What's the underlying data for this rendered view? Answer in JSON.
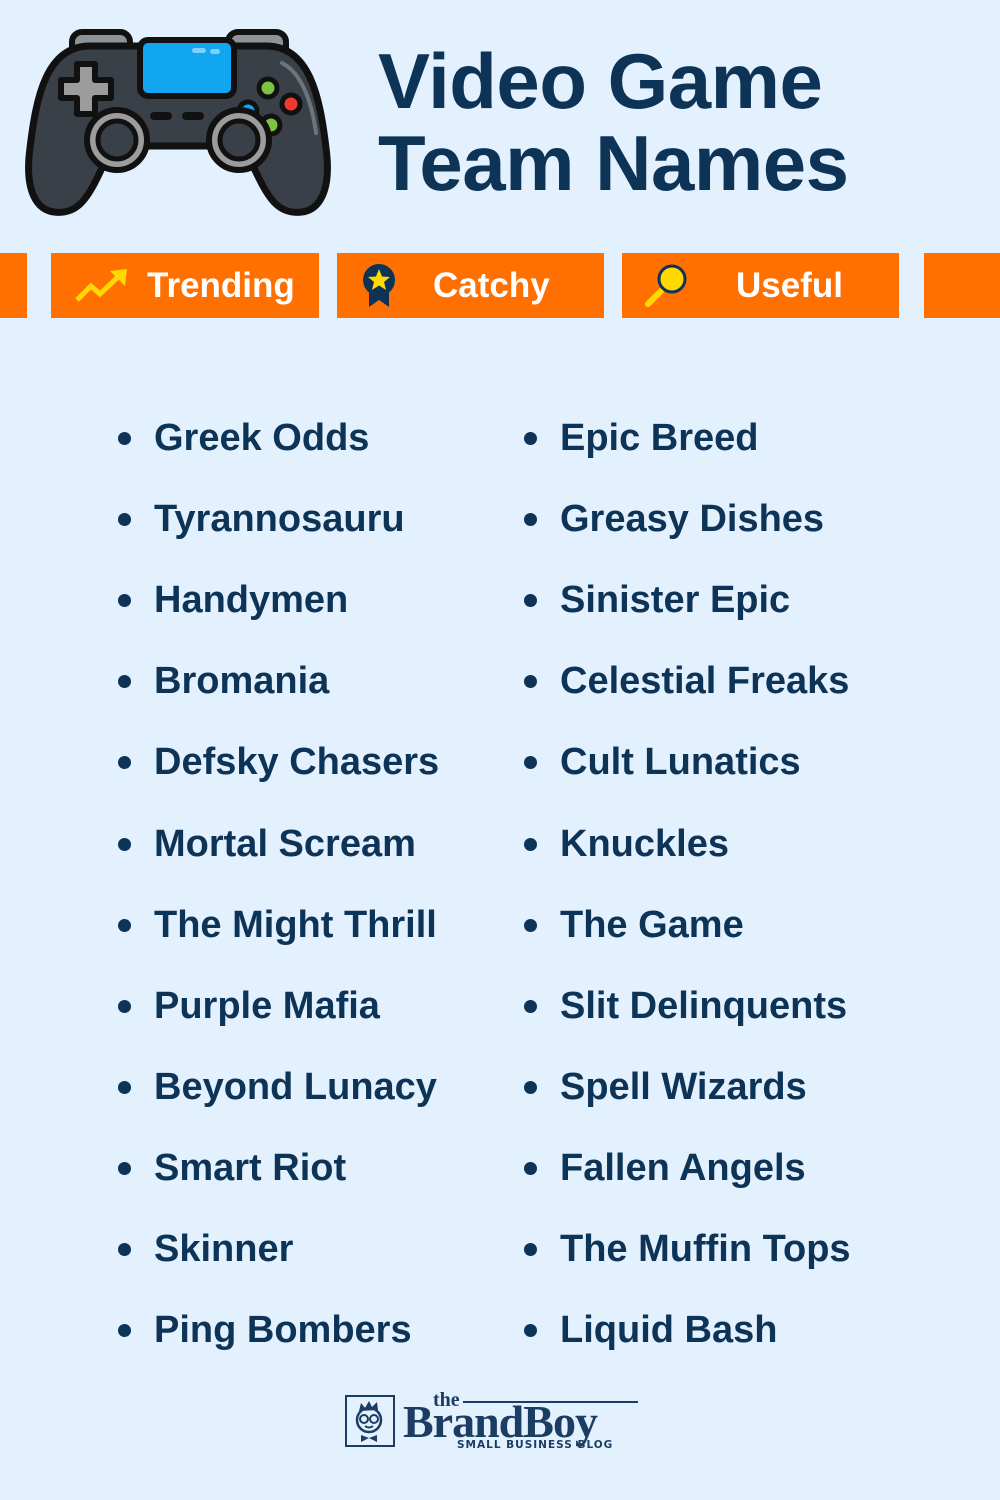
{
  "header": {
    "title_line1": "Video Game",
    "title_line2": "Team Names",
    "hero_icon": "gamepad-controller-icon"
  },
  "colors": {
    "background": "#e3f0fe",
    "text": "#0d3356",
    "tab_background": "#ff7001",
    "tab_text": "#ffffff",
    "accent_yellow": "#ffd900"
  },
  "tabs": [
    {
      "label": "Trending",
      "icon": "trending-up-arrow-icon"
    },
    {
      "label": "Catchy",
      "icon": "award-ribbon-star-icon"
    },
    {
      "label": "Useful",
      "icon": "magnifying-glass-icon"
    }
  ],
  "names": {
    "left": [
      "Greek Odds",
      "Tyrannosauru",
      "Handymen",
      "Bromania",
      "Defsky Chasers",
      "Mortal Scream",
      "The Might Thrill",
      "Purple Mafia",
      "Beyond Lunacy",
      "Smart Riot",
      "Skinner",
      "Ping Bombers"
    ],
    "right": [
      "Epic Breed",
      "Greasy Dishes",
      "Sinister Epic",
      "Celestial Freaks",
      "Cult Lunatics",
      "Knuckles",
      "The Game",
      "Slit Delinquents",
      "Spell Wizards",
      "Fallen Angels",
      "The Muffin Tops",
      "Liquid Bash"
    ]
  },
  "footer": {
    "logo_the": "the",
    "logo_brand": "BrandBoy",
    "logo_tagline": "SMALL BUSINESS BLOG",
    "logo_icon": "brandboy-mascot-icon"
  }
}
